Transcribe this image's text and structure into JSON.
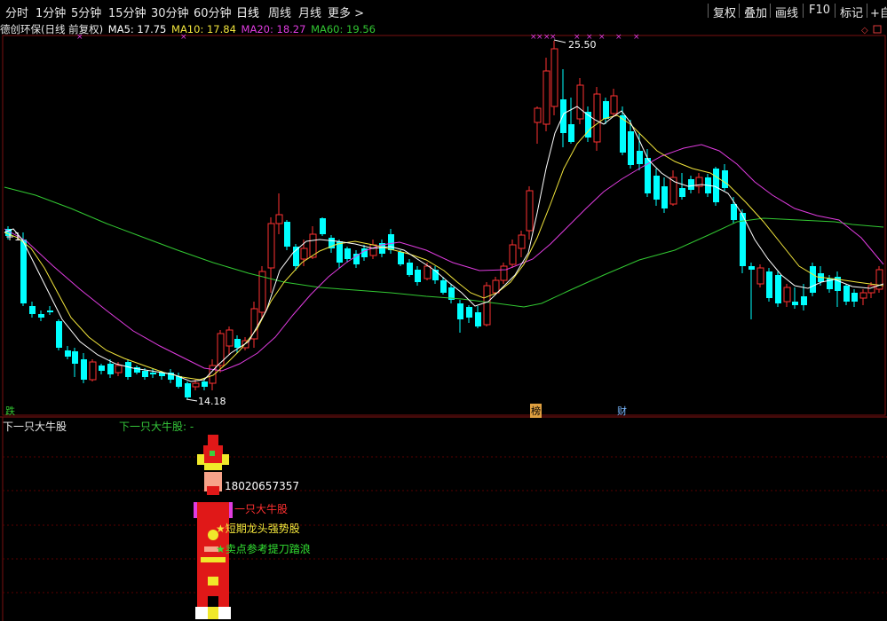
{
  "toolbar": {
    "tabs": [
      "分时",
      "1分钟",
      "5分钟",
      "15分钟",
      "30分钟",
      "60分钟",
      "日线",
      "周线",
      "月线",
      "更多 >"
    ],
    "active_tab": "日线",
    "tools": [
      "复权",
      "叠加",
      "画线",
      "F10",
      "标记",
      "+自选"
    ]
  },
  "titlebar": {
    "stock": "德创环保(日线 前复权)",
    "ma5": "MA5: 17.75",
    "ma10": "MA10: 17.84",
    "ma20": "MA20: 18.27",
    "ma60": "MA60: 19.56",
    "colors": {
      "ma5": "#ffffff",
      "ma10": "#f3e63c",
      "ma20": "#e03ce0",
      "ma60": "#32c832"
    }
  },
  "price_labels": {
    "high": "25.50",
    "low": "14.18"
  },
  "event_markers": {
    "die": "跌",
    "bang": "榜",
    "cai": "财"
  },
  "subpanel": {
    "title": "下一只大牛股",
    "formula_name": "下一只大牛股: -",
    "phone": "18020657357",
    "line1": "一只大牛股",
    "line2": "★短期龙头强势股",
    "line3": "★卖点参考提刀踏浪"
  },
  "chart_data": {
    "type": "candlestick",
    "title": "德创环保(日线 前复权)",
    "price_high_marked": 25.5,
    "price_low_marked": 14.18,
    "ma_latest": {
      "MA5": 17.75,
      "MA10": 17.84,
      "MA20": 18.27,
      "MA60": 19.56
    },
    "colors": {
      "up": "#ff3232",
      "down": "#00ffff",
      "ma5": "#ffffff",
      "ma10": "#f3e63c",
      "ma20": "#e03ce0",
      "ma60": "#32c832"
    }
  }
}
